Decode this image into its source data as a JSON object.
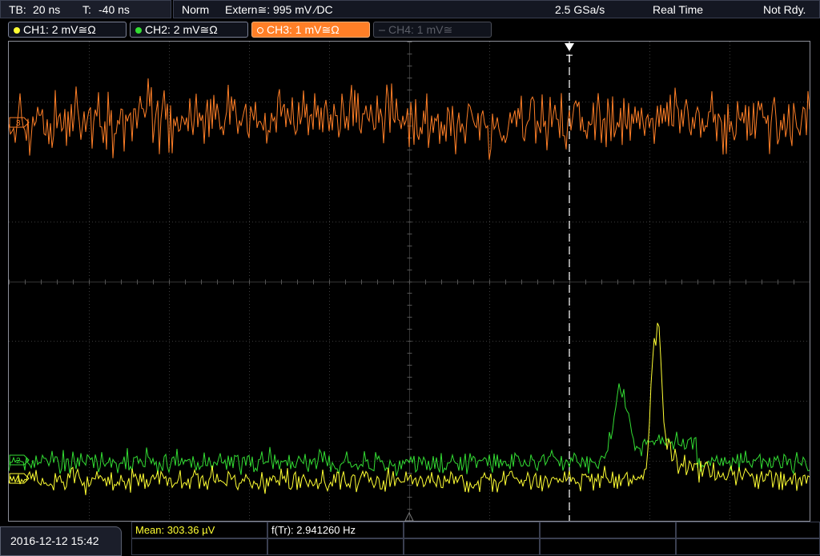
{
  "topbar": {
    "tb_label": "TB:",
    "tb_value": "20 ns",
    "t_label": "T:",
    "t_value": "-40 ns",
    "trigger_mode": "Norm",
    "trigger_source": "Extern≅: 995 mV ⁄DC",
    "sample_rate": "2.5 GSa/s",
    "acq_mode": "Real Time",
    "status": "Not Rdy."
  },
  "channels": [
    {
      "label": "CH1: 2 mV≅Ω",
      "color": "#ffff33",
      "state": "on"
    },
    {
      "label": "CH2: 2 mV≅Ω",
      "color": "#33dd33",
      "state": "on"
    },
    {
      "label": "CH3: 1 mV≅Ω",
      "color": "#ff7f27",
      "state": "active"
    },
    {
      "label": "CH4: 1 mV≅",
      "color": "#5a5d66",
      "state": "off"
    }
  ],
  "trigger_marker": "T",
  "ch_markers": {
    "ch1": "1",
    "ch2": "2",
    "ch3": "3"
  },
  "footer": {
    "datetime": "2016-12-12 15:42",
    "mean_label": "Mean: 303.36 µV",
    "freq_label": "f(Tr): 2.941260 Hz"
  },
  "colors": {
    "ch1": "#ffff33",
    "ch2": "#33dd33",
    "ch3": "#ff7f27",
    "grid": "#3a3a3a",
    "trigger_line": "#ffffff"
  }
}
